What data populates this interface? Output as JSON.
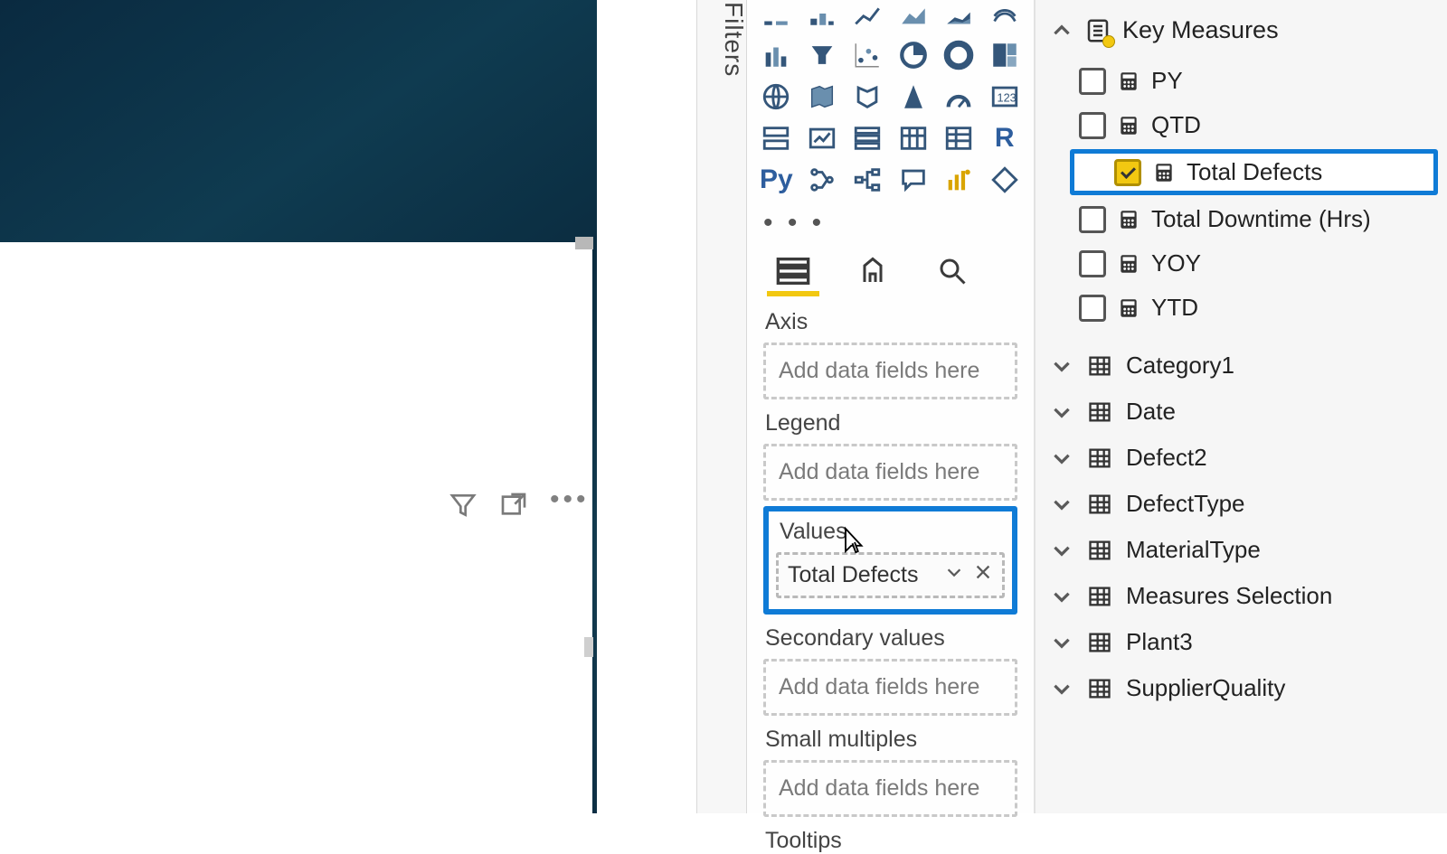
{
  "filters_label": "Filters",
  "viz_more": "• • •",
  "wells": {
    "axis_label": "Axis",
    "legend_label": "Legend",
    "values_label": "Values",
    "secondary_label": "Secondary values",
    "small_mult_label": "Small multiples",
    "tooltips_label": "Tooltips",
    "placeholder": "Add data fields here",
    "values_chip": "Total Defects"
  },
  "fields": {
    "group_name": "Key Measures",
    "measures": [
      {
        "label": "PY",
        "checked": false
      },
      {
        "label": "QTD",
        "checked": false
      },
      {
        "label": "Total Defects",
        "checked": true,
        "highlight": true
      },
      {
        "label": "Total Downtime (Hrs)",
        "checked": false
      },
      {
        "label": "YOY",
        "checked": false
      },
      {
        "label": "YTD",
        "checked": false
      }
    ],
    "tables": [
      "Category1",
      "Date",
      "Defect2",
      "DefectType",
      "MaterialType",
      "Measures Selection",
      "Plant3",
      "SupplierQuality"
    ]
  }
}
